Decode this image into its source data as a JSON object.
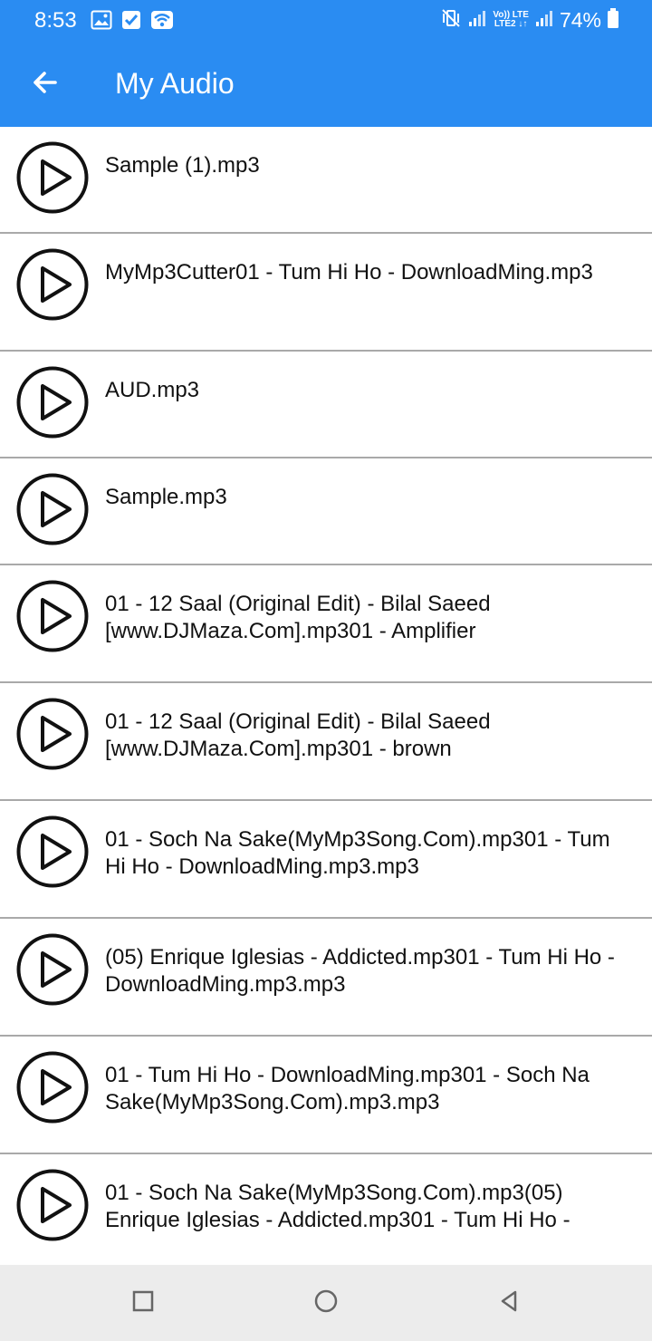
{
  "status_bar": {
    "time": "8:53",
    "battery": "74%",
    "network_label_top": "Vo)) LTE",
    "network_label_bottom": "LTE2 ↓↑",
    "left_icons": [
      "image-icon",
      "checkbox-icon",
      "wifi-icon"
    ],
    "right_icons": [
      "mute-vibrate-icon",
      "signal-icon",
      "signal-icon",
      "battery-icon"
    ]
  },
  "app_bar": {
    "title": "My Audio",
    "back_icon": "arrow-left-icon",
    "color": "#2a8cf2"
  },
  "audio_items": [
    {
      "label": "Sample (1).mp3"
    },
    {
      "label": "MyMp3Cutter01 - Tum Hi Ho - DownloadMing.mp3"
    },
    {
      "label": "AUD.mp3"
    },
    {
      "label": "Sample.mp3"
    },
    {
      "label": "01 - 12 Saal (Original Edit) - Bilal Saeed [www.DJMaza.Com].mp301 - Amplifier"
    },
    {
      "label": "01 - 12 Saal (Original Edit) - Bilal Saeed [www.DJMaza.Com].mp301 - brown"
    },
    {
      "label": "01 - Soch Na Sake(MyMp3Song.Com).mp301 - Tum Hi Ho - DownloadMing.mp3.mp3"
    },
    {
      "label": "(05) Enrique Iglesias - Addicted.mp301 - Tum Hi Ho - DownloadMing.mp3.mp3"
    },
    {
      "label": "01 - Tum Hi Ho - DownloadMing.mp301 - Soch Na Sake(MyMp3Song.Com).mp3.mp3"
    },
    {
      "label": "01 - Soch Na Sake(MyMp3Song.Com).mp3(05) Enrique Iglesias - Addicted.mp301 - Tum Hi Ho -"
    }
  ],
  "nav_bar": {
    "icons": [
      "recent-apps-icon",
      "home-icon",
      "back-icon"
    ]
  }
}
